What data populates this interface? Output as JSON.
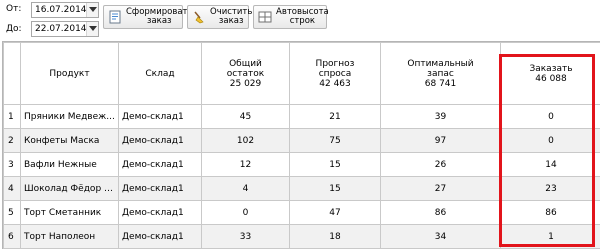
{
  "filters": {
    "from_label": "От:",
    "from_value": "16.07.2014",
    "to_label": "До:",
    "to_value": "22.07.2014"
  },
  "toolbar": {
    "generate_label": "Сформировать заказ",
    "clear_label": "Очистить заказ",
    "autoheight_label": "Автовысота строк"
  },
  "table": {
    "columns": [
      {
        "title": "",
        "subtotal": ""
      },
      {
        "title": "Продукт",
        "subtotal": ""
      },
      {
        "title": "Склад",
        "subtotal": ""
      },
      {
        "title": "Общий остаток",
        "subtotal": "25 029"
      },
      {
        "title": "Прогноз спроса",
        "subtotal": "42 463"
      },
      {
        "title": "Оптимальный запас",
        "subtotal": "68 741"
      },
      {
        "title": "Заказать",
        "subtotal": "46 088"
      }
    ],
    "rows": [
      [
        "1",
        "Пряники Медвеж...",
        "Демо-склад1",
        "45",
        "21",
        "39",
        "0"
      ],
      [
        "2",
        "Конфеты Маска",
        "Демо-склад1",
        "102",
        "75",
        "97",
        "0"
      ],
      [
        "3",
        "Вафли Нежные",
        "Демо-склад1",
        "12",
        "15",
        "26",
        "14"
      ],
      [
        "4",
        "Шоколад Фёдор Д...",
        "Демо-склад1",
        "4",
        "15",
        "27",
        "23"
      ],
      [
        "5",
        "Торт Сметанник",
        "Демо-склад1",
        "0",
        "47",
        "86",
        "86"
      ],
      [
        "6",
        "Торт Наполеон",
        "Демо-склад1",
        "33",
        "18",
        "34",
        "1"
      ]
    ]
  },
  "colors": {
    "highlight": "#e2141b"
  }
}
